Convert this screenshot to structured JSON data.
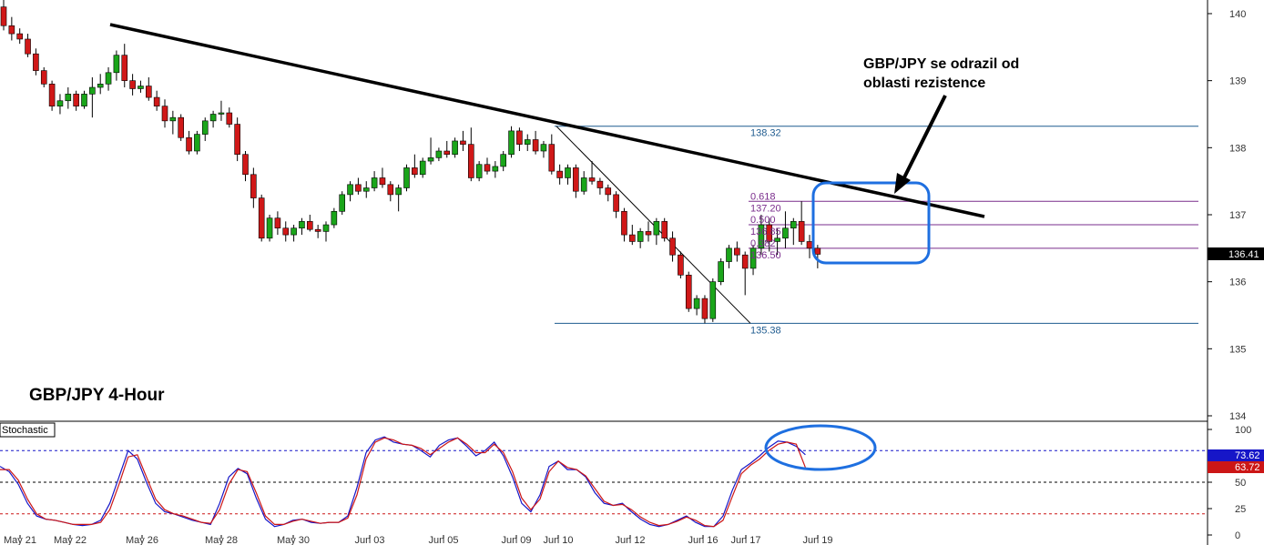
{
  "chart_data": [
    {
      "type": "candlestick",
      "title": "GBP/JPY 4-Hour",
      "ylim": [
        133.8,
        140.2
      ],
      "y_ticks": [
        134,
        135,
        136,
        137,
        138,
        139,
        140
      ],
      "x_tick_labels": [
        "May 21",
        "May 22",
        "May 26",
        "May 28",
        "May 30",
        "Jun 03",
        "Jun 05",
        "Jun 09",
        "Jun 10",
        "Jun 12",
        "Jun 16",
        "Jun 17",
        "Jun 19"
      ],
      "current_price": "136.41",
      "colors": {
        "up": "#1aa51a",
        "down": "#d01818",
        "trendline": "#000000",
        "fib": "#7a2d8c",
        "levels": "#1f5b8f",
        "highlight": "#1e6fe0"
      },
      "candles": [
        [
          140.1,
          140.25,
          139.75,
          139.82
        ],
        [
          139.82,
          139.95,
          139.6,
          139.7
        ],
        [
          139.7,
          139.78,
          139.55,
          139.62
        ],
        [
          139.62,
          139.7,
          139.35,
          139.4
        ],
        [
          139.4,
          139.48,
          139.08,
          139.15
        ],
        [
          139.15,
          139.2,
          138.9,
          138.95
        ],
        [
          138.95,
          139.0,
          138.55,
          138.62
        ],
        [
          138.62,
          138.8,
          138.5,
          138.7
        ],
        [
          138.7,
          138.9,
          138.58,
          138.8
        ],
        [
          138.8,
          138.85,
          138.55,
          138.62
        ],
        [
          138.62,
          138.85,
          138.58,
          138.8
        ],
        [
          138.8,
          139.05,
          138.45,
          138.9
        ],
        [
          138.9,
          139.1,
          138.8,
          138.95
        ],
        [
          138.95,
          139.2,
          138.85,
          139.12
        ],
        [
          139.12,
          139.45,
          139.0,
          139.38
        ],
        [
          139.38,
          139.55,
          138.9,
          139.0
        ],
        [
          139.0,
          139.1,
          138.78,
          138.88
        ],
        [
          138.88,
          139.0,
          138.82,
          138.92
        ],
        [
          138.92,
          139.05,
          138.7,
          138.75
        ],
        [
          138.75,
          138.85,
          138.55,
          138.62
        ],
        [
          138.62,
          138.72,
          138.3,
          138.4
        ],
        [
          138.4,
          138.55,
          138.2,
          138.45
        ],
        [
          138.45,
          138.5,
          138.1,
          138.15
        ],
        [
          138.15,
          138.25,
          137.9,
          137.95
        ],
        [
          137.95,
          138.25,
          137.9,
          138.2
        ],
        [
          138.2,
          138.45,
          138.1,
          138.4
        ],
        [
          138.4,
          138.55,
          138.3,
          138.5
        ],
        [
          138.5,
          138.7,
          138.4,
          138.52
        ],
        [
          138.52,
          138.6,
          138.3,
          138.35
        ],
        [
          138.35,
          138.45,
          137.8,
          137.9
        ],
        [
          137.9,
          137.95,
          137.5,
          137.6
        ],
        [
          137.6,
          137.7,
          137.1,
          137.25
        ],
        [
          137.25,
          137.3,
          136.6,
          136.65
        ],
        [
          136.65,
          137.0,
          136.6,
          136.95
        ],
        [
          136.95,
          137.05,
          136.7,
          136.8
        ],
        [
          136.8,
          136.9,
          136.6,
          136.7
        ],
        [
          136.7,
          136.85,
          136.6,
          136.8
        ],
        [
          136.8,
          136.95,
          136.7,
          136.9
        ],
        [
          136.9,
          137.0,
          136.75,
          136.78
        ],
        [
          136.78,
          136.85,
          136.65,
          136.75
        ],
        [
          136.75,
          136.9,
          136.6,
          136.85
        ],
        [
          136.85,
          137.1,
          136.8,
          137.05
        ],
        [
          137.05,
          137.35,
          137.0,
          137.3
        ],
        [
          137.3,
          137.5,
          137.2,
          137.45
        ],
        [
          137.45,
          137.55,
          137.3,
          137.35
        ],
        [
          137.35,
          137.5,
          137.25,
          137.4
        ],
        [
          137.4,
          137.65,
          137.35,
          137.55
        ],
        [
          137.55,
          137.7,
          137.4,
          137.45
        ],
        [
          137.45,
          137.5,
          137.2,
          137.3
        ],
        [
          137.3,
          137.45,
          137.05,
          137.4
        ],
        [
          137.4,
          137.75,
          137.35,
          137.7
        ],
        [
          137.7,
          137.9,
          137.55,
          137.6
        ],
        [
          137.6,
          137.85,
          137.55,
          137.8
        ],
        [
          137.8,
          138.15,
          137.75,
          137.85
        ],
        [
          137.85,
          138.0,
          137.8,
          137.95
        ],
        [
          137.95,
          138.1,
          137.85,
          137.9
        ],
        [
          137.9,
          138.15,
          137.85,
          138.1
        ],
        [
          138.1,
          138.25,
          137.95,
          138.05
        ],
        [
          138.05,
          138.3,
          137.5,
          137.55
        ],
        [
          137.55,
          137.8,
          137.5,
          137.75
        ],
        [
          137.75,
          137.85,
          137.6,
          137.65
        ],
        [
          137.65,
          137.8,
          137.55,
          137.72
        ],
        [
          137.72,
          137.95,
          137.65,
          137.9
        ],
        [
          137.9,
          138.32,
          137.85,
          138.25
        ],
        [
          138.25,
          138.3,
          137.95,
          138.05
        ],
        [
          138.05,
          138.2,
          137.95,
          138.12
        ],
        [
          138.12,
          138.25,
          137.9,
          137.95
        ],
        [
          137.95,
          138.1,
          137.85,
          138.05
        ],
        [
          138.05,
          138.2,
          137.6,
          137.65
        ],
        [
          137.65,
          137.75,
          137.45,
          137.55
        ],
        [
          137.55,
          137.75,
          137.45,
          137.7
        ],
        [
          137.7,
          137.75,
          137.25,
          137.35
        ],
        [
          137.35,
          137.65,
          137.3,
          137.55
        ],
        [
          137.55,
          137.8,
          137.45,
          137.5
        ],
        [
          137.5,
          137.55,
          137.3,
          137.4
        ],
        [
          137.4,
          137.45,
          137.2,
          137.3
        ],
        [
          137.3,
          137.35,
          136.95,
          137.05
        ],
        [
          137.05,
          137.1,
          136.6,
          136.7
        ],
        [
          136.7,
          136.85,
          136.55,
          136.6
        ],
        [
          136.6,
          136.8,
          136.5,
          136.75
        ],
        [
          136.75,
          136.9,
          136.6,
          136.7
        ],
        [
          136.7,
          136.95,
          136.55,
          136.9
        ],
        [
          136.9,
          136.95,
          136.6,
          136.65
        ],
        [
          136.65,
          136.75,
          136.3,
          136.4
        ],
        [
          136.4,
          136.45,
          136.05,
          136.1
        ],
        [
          136.1,
          136.15,
          135.55,
          135.6
        ],
        [
          135.6,
          135.8,
          135.5,
          135.75
        ],
        [
          135.75,
          135.8,
          135.38,
          135.45
        ],
        [
          135.45,
          136.05,
          135.4,
          136.0
        ],
        [
          136.0,
          136.35,
          135.95,
          136.3
        ],
        [
          136.3,
          136.55,
          136.2,
          136.5
        ],
        [
          136.5,
          136.6,
          136.3,
          136.4
        ],
        [
          136.4,
          136.45,
          135.8,
          136.2
        ],
        [
          136.2,
          136.55,
          136.1,
          136.5
        ],
        [
          136.5,
          137.0,
          136.4,
          136.85
        ],
        [
          136.85,
          136.95,
          136.45,
          136.6
        ],
        [
          136.6,
          136.8,
          136.4,
          136.65
        ],
        [
          136.65,
          137.05,
          136.5,
          136.8
        ],
        [
          136.8,
          136.95,
          136.55,
          136.9
        ],
        [
          136.9,
          137.2,
          136.55,
          136.6
        ],
        [
          136.6,
          136.7,
          136.35,
          136.5
        ],
        [
          136.5,
          136.55,
          136.2,
          136.41
        ]
      ],
      "annotations": {
        "resistance_text_line1": "GBP/JPY se odrazil od",
        "resistance_text_line2": "oblasti rezistence",
        "high_level": "138.32",
        "low_level": "135.38",
        "fib_levels": [
          {
            "ratio": "0.618",
            "price": "137.20",
            "value": 137.2
          },
          {
            "ratio": "0.500",
            "price": "136.85",
            "value": 136.85
          },
          {
            "ratio": "0.382",
            "price": "136.50",
            "value": 136.5
          }
        ]
      }
    },
    {
      "type": "line",
      "name": "Stochastic",
      "ylim": [
        0,
        100
      ],
      "y_ticks": [
        0,
        25,
        50,
        75,
        100
      ],
      "levels": [
        80,
        50,
        20
      ],
      "current_values": [
        "73.62",
        "63.72"
      ],
      "colors": {
        "main": "#1616c8",
        "signal": "#cc1616"
      },
      "series": [
        {
          "values": [
            65,
            60,
            48,
            30,
            18,
            15,
            14,
            12,
            10,
            9,
            10,
            14,
            30,
            55,
            80,
            72,
            50,
            30,
            22,
            20,
            17,
            14,
            12,
            10,
            30,
            55,
            63,
            58,
            35,
            15,
            8,
            10,
            14,
            15,
            12,
            11,
            12,
            12,
            18,
            45,
            78,
            90,
            93,
            88,
            86,
            85,
            80,
            74,
            85,
            90,
            92,
            84,
            75,
            80,
            88,
            75,
            55,
            30,
            22,
            38,
            65,
            70,
            62,
            62,
            55,
            40,
            30,
            28,
            30,
            22,
            15,
            10,
            8,
            10,
            14,
            18,
            12,
            8,
            8,
            18,
            42,
            62,
            68,
            75,
            83,
            89,
            88,
            84,
            76
          ]
        },
        {
          "values": [
            62,
            62,
            52,
            34,
            20,
            15,
            14,
            12,
            10,
            10,
            10,
            12,
            24,
            48,
            74,
            76,
            55,
            34,
            24,
            20,
            18,
            15,
            12,
            11,
            24,
            48,
            62,
            60,
            40,
            18,
            10,
            10,
            13,
            15,
            13,
            11,
            12,
            12,
            16,
            38,
            72,
            88,
            92,
            90,
            86,
            85,
            82,
            76,
            82,
            88,
            92,
            86,
            78,
            78,
            86,
            78,
            60,
            35,
            24,
            34,
            60,
            70,
            64,
            62,
            56,
            44,
            32,
            28,
            29,
            24,
            17,
            12,
            9,
            10,
            13,
            17,
            14,
            9,
            8,
            14,
            36,
            58,
            66,
            72,
            80,
            86,
            88,
            86,
            64
          ]
        }
      ]
    }
  ]
}
